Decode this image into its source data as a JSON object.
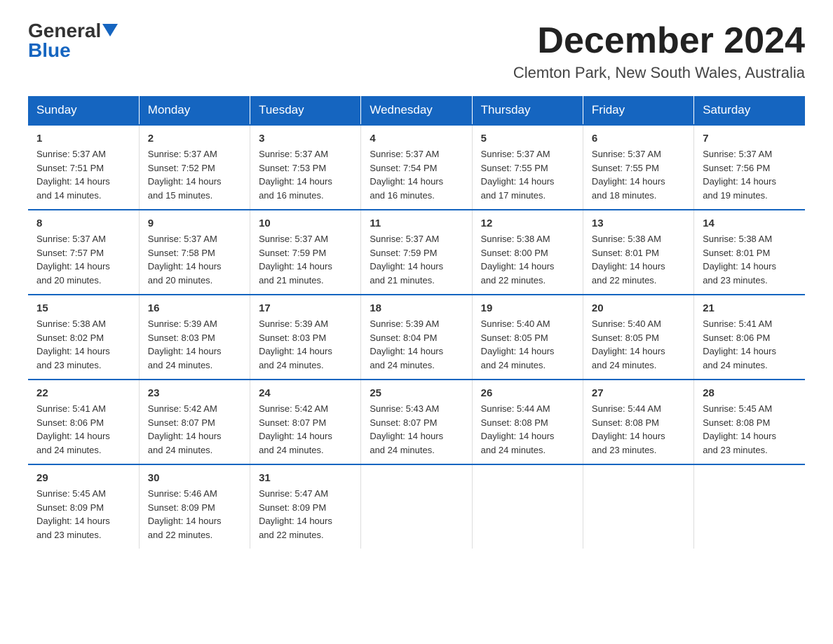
{
  "logo": {
    "general": "General",
    "blue": "Blue"
  },
  "title": "December 2024",
  "location": "Clemton Park, New South Wales, Australia",
  "days_of_week": [
    "Sunday",
    "Monday",
    "Tuesday",
    "Wednesday",
    "Thursday",
    "Friday",
    "Saturday"
  ],
  "weeks": [
    [
      {
        "day": "1",
        "sunrise": "5:37 AM",
        "sunset": "7:51 PM",
        "daylight": "14 hours and 14 minutes."
      },
      {
        "day": "2",
        "sunrise": "5:37 AM",
        "sunset": "7:52 PM",
        "daylight": "14 hours and 15 minutes."
      },
      {
        "day": "3",
        "sunrise": "5:37 AM",
        "sunset": "7:53 PM",
        "daylight": "14 hours and 16 minutes."
      },
      {
        "day": "4",
        "sunrise": "5:37 AM",
        "sunset": "7:54 PM",
        "daylight": "14 hours and 16 minutes."
      },
      {
        "day": "5",
        "sunrise": "5:37 AM",
        "sunset": "7:55 PM",
        "daylight": "14 hours and 17 minutes."
      },
      {
        "day": "6",
        "sunrise": "5:37 AM",
        "sunset": "7:55 PM",
        "daylight": "14 hours and 18 minutes."
      },
      {
        "day": "7",
        "sunrise": "5:37 AM",
        "sunset": "7:56 PM",
        "daylight": "14 hours and 19 minutes."
      }
    ],
    [
      {
        "day": "8",
        "sunrise": "5:37 AM",
        "sunset": "7:57 PM",
        "daylight": "14 hours and 20 minutes."
      },
      {
        "day": "9",
        "sunrise": "5:37 AM",
        "sunset": "7:58 PM",
        "daylight": "14 hours and 20 minutes."
      },
      {
        "day": "10",
        "sunrise": "5:37 AM",
        "sunset": "7:59 PM",
        "daylight": "14 hours and 21 minutes."
      },
      {
        "day": "11",
        "sunrise": "5:37 AM",
        "sunset": "7:59 PM",
        "daylight": "14 hours and 21 minutes."
      },
      {
        "day": "12",
        "sunrise": "5:38 AM",
        "sunset": "8:00 PM",
        "daylight": "14 hours and 22 minutes."
      },
      {
        "day": "13",
        "sunrise": "5:38 AM",
        "sunset": "8:01 PM",
        "daylight": "14 hours and 22 minutes."
      },
      {
        "day": "14",
        "sunrise": "5:38 AM",
        "sunset": "8:01 PM",
        "daylight": "14 hours and 23 minutes."
      }
    ],
    [
      {
        "day": "15",
        "sunrise": "5:38 AM",
        "sunset": "8:02 PM",
        "daylight": "14 hours and 23 minutes."
      },
      {
        "day": "16",
        "sunrise": "5:39 AM",
        "sunset": "8:03 PM",
        "daylight": "14 hours and 24 minutes."
      },
      {
        "day": "17",
        "sunrise": "5:39 AM",
        "sunset": "8:03 PM",
        "daylight": "14 hours and 24 minutes."
      },
      {
        "day": "18",
        "sunrise": "5:39 AM",
        "sunset": "8:04 PM",
        "daylight": "14 hours and 24 minutes."
      },
      {
        "day": "19",
        "sunrise": "5:40 AM",
        "sunset": "8:05 PM",
        "daylight": "14 hours and 24 minutes."
      },
      {
        "day": "20",
        "sunrise": "5:40 AM",
        "sunset": "8:05 PM",
        "daylight": "14 hours and 24 minutes."
      },
      {
        "day": "21",
        "sunrise": "5:41 AM",
        "sunset": "8:06 PM",
        "daylight": "14 hours and 24 minutes."
      }
    ],
    [
      {
        "day": "22",
        "sunrise": "5:41 AM",
        "sunset": "8:06 PM",
        "daylight": "14 hours and 24 minutes."
      },
      {
        "day": "23",
        "sunrise": "5:42 AM",
        "sunset": "8:07 PM",
        "daylight": "14 hours and 24 minutes."
      },
      {
        "day": "24",
        "sunrise": "5:42 AM",
        "sunset": "8:07 PM",
        "daylight": "14 hours and 24 minutes."
      },
      {
        "day": "25",
        "sunrise": "5:43 AM",
        "sunset": "8:07 PM",
        "daylight": "14 hours and 24 minutes."
      },
      {
        "day": "26",
        "sunrise": "5:44 AM",
        "sunset": "8:08 PM",
        "daylight": "14 hours and 24 minutes."
      },
      {
        "day": "27",
        "sunrise": "5:44 AM",
        "sunset": "8:08 PM",
        "daylight": "14 hours and 23 minutes."
      },
      {
        "day": "28",
        "sunrise": "5:45 AM",
        "sunset": "8:08 PM",
        "daylight": "14 hours and 23 minutes."
      }
    ],
    [
      {
        "day": "29",
        "sunrise": "5:45 AM",
        "sunset": "8:09 PM",
        "daylight": "14 hours and 23 minutes."
      },
      {
        "day": "30",
        "sunrise": "5:46 AM",
        "sunset": "8:09 PM",
        "daylight": "14 hours and 22 minutes."
      },
      {
        "day": "31",
        "sunrise": "5:47 AM",
        "sunset": "8:09 PM",
        "daylight": "14 hours and 22 minutes."
      },
      null,
      null,
      null,
      null
    ]
  ],
  "labels": {
    "sunrise": "Sunrise:",
    "sunset": "Sunset:",
    "daylight": "Daylight:"
  }
}
